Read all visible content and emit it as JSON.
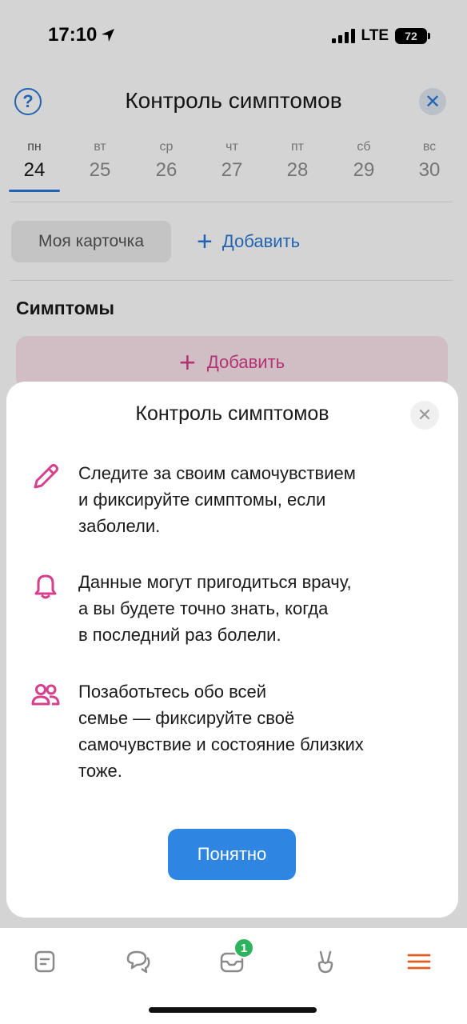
{
  "status": {
    "time": "17:10",
    "network": "LTE",
    "battery": "72"
  },
  "header": {
    "title": "Контроль симптомов",
    "help_icon": "question-circle-icon",
    "close_icon": "close-icon"
  },
  "week": [
    {
      "name": "пн",
      "num": "24",
      "active": true
    },
    {
      "name": "вт",
      "num": "25"
    },
    {
      "name": "ср",
      "num": "26"
    },
    {
      "name": "чт",
      "num": "27"
    },
    {
      "name": "пт",
      "num": "28"
    },
    {
      "name": "сб",
      "num": "29"
    },
    {
      "name": "вс",
      "num": "30"
    }
  ],
  "cards": {
    "my_card": "Моя карточка",
    "add": "Добавить"
  },
  "symptoms": {
    "title": "Симптомы",
    "add": "Добавить"
  },
  "sheet": {
    "title": "Контроль симптомов",
    "features": [
      {
        "icon": "pencil-icon",
        "text": "Следите за своим самочувствием\nи фиксируйте симптомы, если\nзаболели."
      },
      {
        "icon": "bell-icon",
        "text": "Данные могут пригодиться врачу,\nа вы будете точно знать, когда\nв последний раз болели."
      },
      {
        "icon": "people-icon",
        "text": "Позаботьтесь обо всей\nсемье — фиксируйте своё\nсамочувствие и состояние близких\nтоже."
      }
    ],
    "ok": "Понятно"
  },
  "tabbar": {
    "items": [
      "document-icon",
      "chat-icon",
      "inbox-icon",
      "hand-icon",
      "menu-icon"
    ],
    "badge": "1"
  },
  "colors": {
    "accent_blue": "#2b79d6",
    "button_blue": "#2f86e2",
    "pink": "#d63f8c",
    "menu_orange": "#e05d1d",
    "badge_green": "#2db35d"
  }
}
